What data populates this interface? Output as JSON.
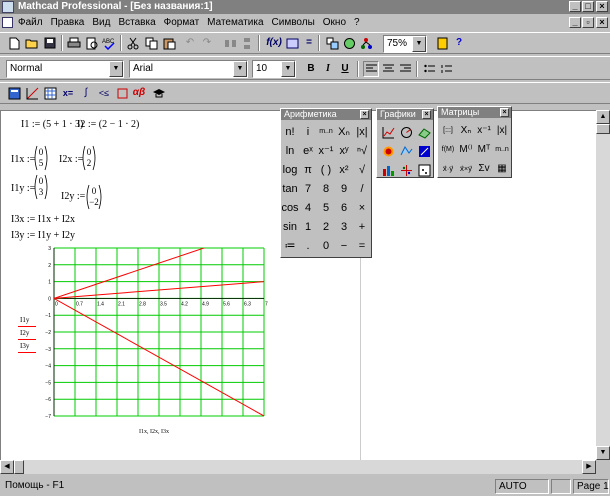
{
  "window": {
    "title": "Mathcad Professional - [Без названия:1]"
  },
  "menu": [
    "Файл",
    "Правка",
    "Вид",
    "Вставка",
    "Формат",
    "Математика",
    "Символы",
    "Окно",
    "?"
  ],
  "toolbar": {
    "zoom": "75%"
  },
  "format_bar": {
    "style": "Normal",
    "font": "Arial",
    "size": "10",
    "bold": "B",
    "italic": "I",
    "underline": "U"
  },
  "math_bar": {
    "eval_label": "x=",
    "greek_label": "αβ"
  },
  "worksheet": {
    "def1": "I1 := (5 + 1 · 3)",
    "def2": "I2 := (2 − 1 · 2)",
    "i1x_label": "I1x :=",
    "i1x_values": [
      "0",
      "5"
    ],
    "i2x_label": "I2x :=",
    "i2x_values": [
      "0",
      "2"
    ],
    "i1y_label": "I1y :=",
    "i1y_values": [
      "0",
      "3"
    ],
    "i2y_label": "I2y :=",
    "i2y_values": [
      "0",
      "−2"
    ],
    "sum_x": "I3x := I1x + I2x",
    "sum_y": "I3y := I1y + I2y",
    "legend_series": [
      "I1y",
      "I2y",
      "I3y"
    ],
    "x_axis_label": "I1x, I2x, I3x"
  },
  "palettes": {
    "arithmetic": {
      "title": "Арифметика",
      "rows": [
        [
          "n!",
          "i",
          "m..n",
          "Xₙ",
          "|x|"
        ],
        [
          "ln",
          "eˣ",
          "x⁻¹",
          "xʸ",
          "ⁿ√"
        ],
        [
          "log",
          "π",
          "( )",
          "x²",
          "√"
        ],
        [
          "tan",
          "7",
          "8",
          "9",
          "/"
        ],
        [
          "cos",
          "4",
          "5",
          "6",
          "×"
        ],
        [
          "sin",
          "1",
          "2",
          "3",
          "+"
        ],
        [
          "≔",
          ".",
          "0",
          "−",
          "="
        ]
      ]
    },
    "graphs": {
      "title": "Графики"
    },
    "matrices": {
      "title": "Матрицы",
      "rows": [
        [
          "[:::]",
          "Xₙ",
          "x⁻¹",
          "|x|"
        ],
        [
          "f(M)",
          "M⁽⁾",
          "Mᵀ",
          "m..n"
        ],
        [
          "x⃗·y⃗",
          "x⃗×y⃗",
          "Σv",
          "▦"
        ]
      ]
    }
  },
  "chart_data": {
    "type": "line",
    "xlim": [
      0,
      7
    ],
    "ylim": [
      -7,
      3
    ],
    "x_ticks": [
      "0",
      "0.7",
      "1.4",
      "2.1",
      "2.8",
      "3.5",
      "4.2",
      "4.9",
      "5.6",
      "6.3",
      "7"
    ],
    "y_ticks": [
      "3",
      "2",
      "1",
      "0",
      "−1",
      "−2",
      "−3",
      "−4",
      "−5",
      "−6",
      "−7"
    ],
    "series": [
      {
        "name": "I1y",
        "x": [
          0,
          5
        ],
        "y": [
          0,
          3
        ],
        "color": "#ff0000"
      },
      {
        "name": "I2y",
        "x": [
          0,
          2
        ],
        "y": [
          0,
          -2
        ],
        "color": "#ff0000"
      },
      {
        "name": "I3y",
        "x": [
          0,
          7
        ],
        "y": [
          0,
          1
        ],
        "color": "#ff0000"
      }
    ],
    "grid": true,
    "grid_color": "#00cc00"
  },
  "status": {
    "help": "Помощь - F1",
    "mode": "AUTO",
    "page": "Page 1"
  }
}
